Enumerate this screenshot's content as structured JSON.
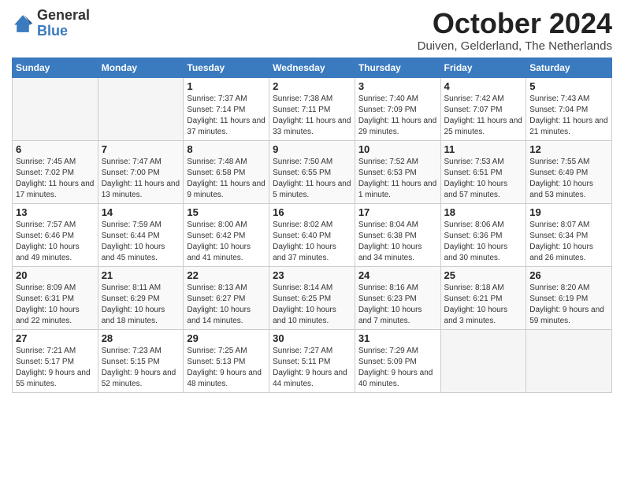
{
  "header": {
    "logo_general": "General",
    "logo_blue": "Blue",
    "month_title": "October 2024",
    "subtitle": "Duiven, Gelderland, The Netherlands"
  },
  "days_of_week": [
    "Sunday",
    "Monday",
    "Tuesday",
    "Wednesday",
    "Thursday",
    "Friday",
    "Saturday"
  ],
  "weeks": [
    [
      {
        "day": "",
        "info": ""
      },
      {
        "day": "",
        "info": ""
      },
      {
        "day": "1",
        "info": "Sunrise: 7:37 AM\nSunset: 7:14 PM\nDaylight: 11 hours and 37 minutes."
      },
      {
        "day": "2",
        "info": "Sunrise: 7:38 AM\nSunset: 7:11 PM\nDaylight: 11 hours and 33 minutes."
      },
      {
        "day": "3",
        "info": "Sunrise: 7:40 AM\nSunset: 7:09 PM\nDaylight: 11 hours and 29 minutes."
      },
      {
        "day": "4",
        "info": "Sunrise: 7:42 AM\nSunset: 7:07 PM\nDaylight: 11 hours and 25 minutes."
      },
      {
        "day": "5",
        "info": "Sunrise: 7:43 AM\nSunset: 7:04 PM\nDaylight: 11 hours and 21 minutes."
      }
    ],
    [
      {
        "day": "6",
        "info": "Sunrise: 7:45 AM\nSunset: 7:02 PM\nDaylight: 11 hours and 17 minutes."
      },
      {
        "day": "7",
        "info": "Sunrise: 7:47 AM\nSunset: 7:00 PM\nDaylight: 11 hours and 13 minutes."
      },
      {
        "day": "8",
        "info": "Sunrise: 7:48 AM\nSunset: 6:58 PM\nDaylight: 11 hours and 9 minutes."
      },
      {
        "day": "9",
        "info": "Sunrise: 7:50 AM\nSunset: 6:55 PM\nDaylight: 11 hours and 5 minutes."
      },
      {
        "day": "10",
        "info": "Sunrise: 7:52 AM\nSunset: 6:53 PM\nDaylight: 11 hours and 1 minute."
      },
      {
        "day": "11",
        "info": "Sunrise: 7:53 AM\nSunset: 6:51 PM\nDaylight: 10 hours and 57 minutes."
      },
      {
        "day": "12",
        "info": "Sunrise: 7:55 AM\nSunset: 6:49 PM\nDaylight: 10 hours and 53 minutes."
      }
    ],
    [
      {
        "day": "13",
        "info": "Sunrise: 7:57 AM\nSunset: 6:46 PM\nDaylight: 10 hours and 49 minutes."
      },
      {
        "day": "14",
        "info": "Sunrise: 7:59 AM\nSunset: 6:44 PM\nDaylight: 10 hours and 45 minutes."
      },
      {
        "day": "15",
        "info": "Sunrise: 8:00 AM\nSunset: 6:42 PM\nDaylight: 10 hours and 41 minutes."
      },
      {
        "day": "16",
        "info": "Sunrise: 8:02 AM\nSunset: 6:40 PM\nDaylight: 10 hours and 37 minutes."
      },
      {
        "day": "17",
        "info": "Sunrise: 8:04 AM\nSunset: 6:38 PM\nDaylight: 10 hours and 34 minutes."
      },
      {
        "day": "18",
        "info": "Sunrise: 8:06 AM\nSunset: 6:36 PM\nDaylight: 10 hours and 30 minutes."
      },
      {
        "day": "19",
        "info": "Sunrise: 8:07 AM\nSunset: 6:34 PM\nDaylight: 10 hours and 26 minutes."
      }
    ],
    [
      {
        "day": "20",
        "info": "Sunrise: 8:09 AM\nSunset: 6:31 PM\nDaylight: 10 hours and 22 minutes."
      },
      {
        "day": "21",
        "info": "Sunrise: 8:11 AM\nSunset: 6:29 PM\nDaylight: 10 hours and 18 minutes."
      },
      {
        "day": "22",
        "info": "Sunrise: 8:13 AM\nSunset: 6:27 PM\nDaylight: 10 hours and 14 minutes."
      },
      {
        "day": "23",
        "info": "Sunrise: 8:14 AM\nSunset: 6:25 PM\nDaylight: 10 hours and 10 minutes."
      },
      {
        "day": "24",
        "info": "Sunrise: 8:16 AM\nSunset: 6:23 PM\nDaylight: 10 hours and 7 minutes."
      },
      {
        "day": "25",
        "info": "Sunrise: 8:18 AM\nSunset: 6:21 PM\nDaylight: 10 hours and 3 minutes."
      },
      {
        "day": "26",
        "info": "Sunrise: 8:20 AM\nSunset: 6:19 PM\nDaylight: 9 hours and 59 minutes."
      }
    ],
    [
      {
        "day": "27",
        "info": "Sunrise: 7:21 AM\nSunset: 5:17 PM\nDaylight: 9 hours and 55 minutes."
      },
      {
        "day": "28",
        "info": "Sunrise: 7:23 AM\nSunset: 5:15 PM\nDaylight: 9 hours and 52 minutes."
      },
      {
        "day": "29",
        "info": "Sunrise: 7:25 AM\nSunset: 5:13 PM\nDaylight: 9 hours and 48 minutes."
      },
      {
        "day": "30",
        "info": "Sunrise: 7:27 AM\nSunset: 5:11 PM\nDaylight: 9 hours and 44 minutes."
      },
      {
        "day": "31",
        "info": "Sunrise: 7:29 AM\nSunset: 5:09 PM\nDaylight: 9 hours and 40 minutes."
      },
      {
        "day": "",
        "info": ""
      },
      {
        "day": "",
        "info": ""
      }
    ]
  ]
}
